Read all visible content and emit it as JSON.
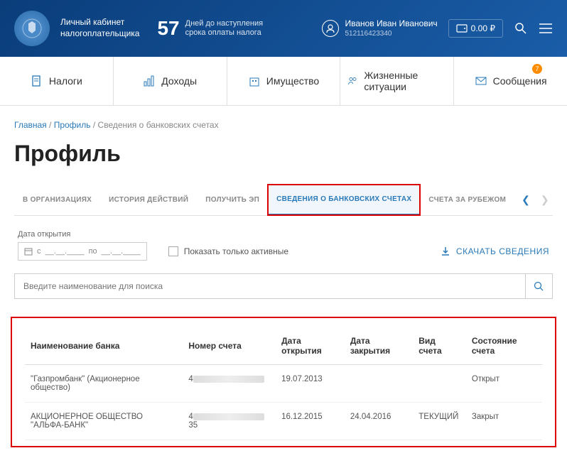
{
  "header": {
    "logo_line1": "Личный кабинет",
    "logo_line2": "налогоплательщика",
    "countdown_num": "57",
    "countdown_line1": "Дней до наступления",
    "countdown_line2": "срока оплаты налога",
    "user_name": "Иванов Иван Иванович",
    "user_id": "512116423340",
    "wallet_amount": "0.00 ₽"
  },
  "nav": {
    "items": [
      {
        "label": "Налоги"
      },
      {
        "label": "Доходы"
      },
      {
        "label": "Имущество"
      },
      {
        "label": "Жизненные ситуации"
      },
      {
        "label": "Сообщения",
        "badge": "7"
      }
    ]
  },
  "breadcrumb": {
    "home": "Главная",
    "profile": "Профиль",
    "current": "Сведения о банковских счетах"
  },
  "page_title": "Профиль",
  "tabs": [
    {
      "label": "В ОРГАНИЗАЦИЯХ"
    },
    {
      "label": "ИСТОРИЯ ДЕЙСТВИЙ"
    },
    {
      "label": "ПОЛУЧИТЬ ЭП"
    },
    {
      "label": "СВЕДЕНИЯ О БАНКОВСКИХ СЧЕТАХ"
    },
    {
      "label": "СЧЕТА ЗА РУБЕЖОМ"
    }
  ],
  "filters": {
    "date_label": "Дата открытия",
    "date_from_prefix": "с",
    "date_from": "__.__.____",
    "date_to_prefix": "по",
    "date_to": "__.__.____",
    "active_only": "Показать только активные",
    "download": "СКАЧАТЬ СВЕДЕНИЯ"
  },
  "search": {
    "placeholder": "Введите наименование для поиска"
  },
  "table": {
    "headers": {
      "bank": "Наименование банка",
      "account": "Номер счета",
      "open_date": "Дата открытия",
      "close_date": "Дата закрытия",
      "type": "Вид счета",
      "status": "Состояние счета"
    },
    "rows": [
      {
        "bank": "\"Газпромбанк\" (Акционерное общество)",
        "account_prefix": "4",
        "account_suffix": "",
        "open_date": "19.07.2013",
        "close_date": "",
        "type": "",
        "status": "Открыт"
      },
      {
        "bank": "АКЦИОНЕРНОЕ ОБЩЕСТВО \"АЛЬФА-БАНК\"",
        "account_prefix": "4",
        "account_suffix": "35",
        "open_date": "16.12.2015",
        "close_date": "24.04.2016",
        "type": "ТЕКУЩИЙ",
        "status": "Закрыт"
      }
    ]
  }
}
